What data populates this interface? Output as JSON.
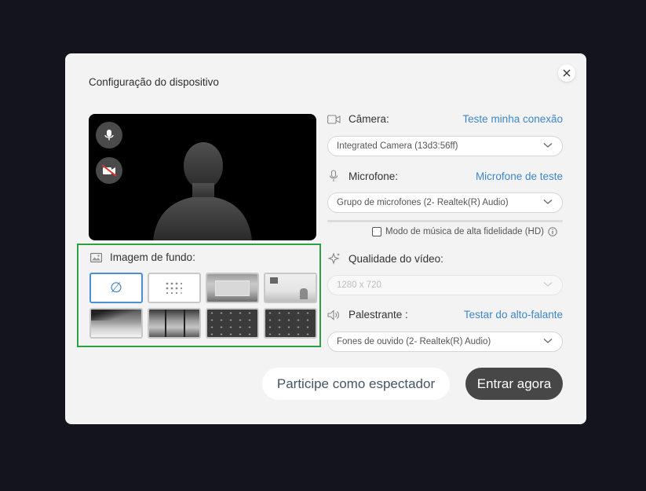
{
  "dialog": {
    "title": "Configuração do dispositivo"
  },
  "background": {
    "label": "Imagem de fundo:",
    "none_symbol": "∅",
    "thumbnails": [
      "none",
      "blur",
      "room-1",
      "room-2",
      "beach",
      "window",
      "pattern-1",
      "pattern-2"
    ]
  },
  "camera": {
    "label": "Câmera:",
    "test_link": "Teste minha conexão",
    "selected": "Integrated Camera (13d3:56ff)"
  },
  "microphone": {
    "label": "Microfone:",
    "test_link": "Microfone de teste",
    "selected": "Grupo de microfones (2- Realtek(R) Audio)",
    "hd_mode_label": "Modo de música de alta fidelidade (HD)",
    "hd_mode_checked": false
  },
  "video_quality": {
    "label": "Qualidade do vídeo:",
    "selected": "1280 x 720"
  },
  "speaker": {
    "label": "Palestrante :",
    "test_link": "Testar do alto-falante",
    "selected": "Fones de ouvido (2- Realtek(R) Audio)"
  },
  "actions": {
    "spectator_label": "Participe como espectador",
    "join_label": "Entrar agora"
  },
  "colors": {
    "link": "#3f86c9",
    "highlight_border": "#2ea043",
    "join_button": "#474747"
  }
}
